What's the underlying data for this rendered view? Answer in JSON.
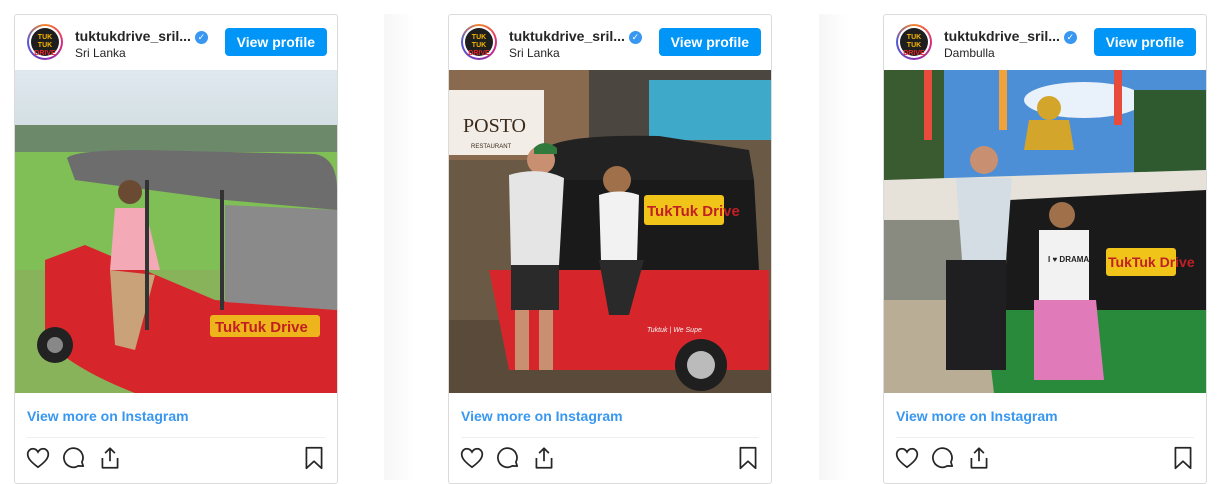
{
  "posts": [
    {
      "username": "tuktukdrive_sril...",
      "location": "Sri Lanka",
      "view_profile": "View profile",
      "view_more": "View more on Instagram",
      "photo_alt": "photo",
      "photo_sign": "TukTuk Drive"
    },
    {
      "username": "tuktukdrive_sril...",
      "location": "Sri Lanka",
      "view_profile": "View profile",
      "view_more": "View more on Instagram",
      "photo_alt": "photo",
      "photo_sign": "TukTuk Drive",
      "photo_shop_sign": "POSTO",
      "photo_shop_subsign": "RESTAURANT",
      "photo_tagline": "Tuktuk | We Supe"
    },
    {
      "username": "tuktukdrive_sril...",
      "location": "Dambulla",
      "view_profile": "View profile",
      "view_more": "View more on Instagram",
      "photo_alt": "photo",
      "photo_sign": "TukTuk Drive",
      "photo_shirt": "I ♥ DRAMA"
    }
  ],
  "avatar_text": {
    "line1": "TUK TUK",
    "line2": "DRIVE"
  },
  "colors": {
    "accent": "#0095f6",
    "link": "#3897f0",
    "border": "#dbdbdb"
  },
  "icons": [
    "heart-icon",
    "comment-icon",
    "share-icon",
    "bookmark-icon",
    "verified-badge-icon"
  ]
}
